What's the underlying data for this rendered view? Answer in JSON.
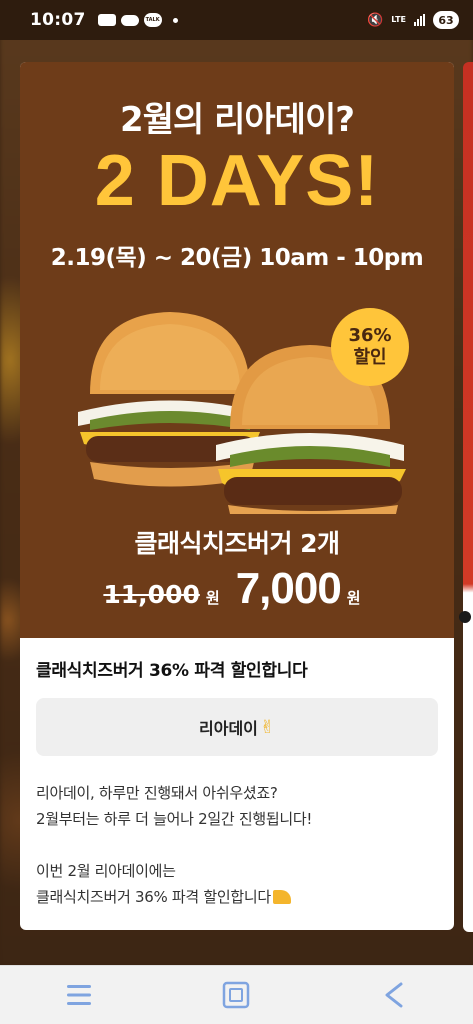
{
  "status_bar": {
    "time": "10:07",
    "talk_label": "TALK",
    "network": "LTE",
    "battery": "63"
  },
  "banner": {
    "question": "2월의 리아데이?",
    "headline": "2 DAYS!",
    "date_range": "2.19(목) ~ 20(금) 10am - 10pm",
    "badge_percent": "36%",
    "badge_label": "할인",
    "product": "클래식치즈버거 2개",
    "old_price": "11,000",
    "old_price_unit": "원",
    "new_price": "7,000",
    "new_price_unit": "원",
    "background_color": "#6e3c19",
    "accent_color": "#ffc53a"
  },
  "post": {
    "title": "클래식치즈버거 36% 파격 할인합니다",
    "tag_button": "리아데이",
    "tag_emoji": "✌",
    "body_lines": [
      "리아데이, 하루만 진행돼서 아쉬우셨죠?",
      "2월부터는 하루 더 늘어나 2일간 진행됩니다!",
      "",
      "이번 2월 리아데이에는",
      "클래식치즈버거 36% 파격 할인합니다"
    ],
    "body_end_icon": "cheese-icon"
  },
  "nav_bar": {
    "icons": [
      "recent-apps-icon",
      "home-icon",
      "back-icon"
    ]
  }
}
